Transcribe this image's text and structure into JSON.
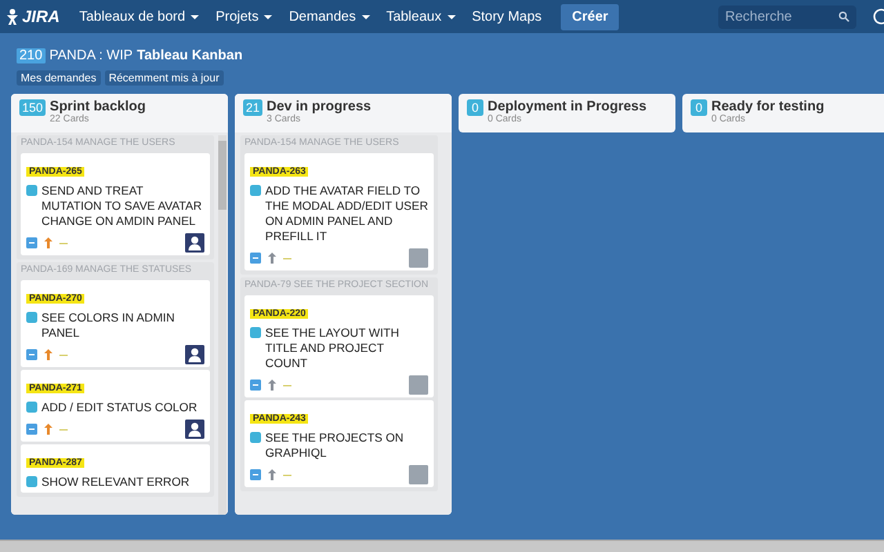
{
  "nav": {
    "logo": "JIRA",
    "menus": [
      {
        "label": "Tableaux de bord",
        "dropdown": true
      },
      {
        "label": "Projets",
        "dropdown": true
      },
      {
        "label": "Demandes",
        "dropdown": true
      },
      {
        "label": "Tableaux",
        "dropdown": true
      },
      {
        "label": "Story Maps",
        "dropdown": false
      }
    ],
    "create": "Créer",
    "search": {
      "placeholder": "Recherche"
    }
  },
  "board": {
    "count": "210",
    "project": "PANDA : WIP",
    "name": "Tableau Kanban",
    "filters": [
      "Mes demandes",
      "Récemment mis à jour"
    ]
  },
  "columns": [
    {
      "count": "150",
      "title": "Sprint backlog",
      "cards_count": "22 Cards",
      "groups": [
        {
          "epic": "PANDA-154 MANAGE THE USERS",
          "cards": [
            {
              "key": "PANDA-265",
              "title": "SEND AND TREAT MUTATION TO SAVE AVATAR CHANGE ON AMDIN PANEL",
              "priority": {
                "color": "#e8892c"
              },
              "avatar": {
                "kind": "silhouette"
              }
            }
          ]
        },
        {
          "epic": "PANDA-169 MANAGE THE STATUSES",
          "cards": [
            {
              "key": "PANDA-270",
              "title": "SEE COLORS IN ADMIN PANEL",
              "priority": {
                "color": "#e8892c"
              },
              "avatar": {
                "kind": "silhouette"
              }
            },
            {
              "key": "PANDA-271",
              "title": "ADD / EDIT STATUS COLOR",
              "priority": {
                "color": "#e8892c"
              },
              "avatar": {
                "kind": "silhouette"
              }
            },
            {
              "key": "PANDA-287",
              "title": "SHOW RELEVANT ERROR"
            }
          ]
        }
      ]
    },
    {
      "count": "21",
      "title": "Dev in progress",
      "cards_count": "3 Cards",
      "groups": [
        {
          "epic": "PANDA-154 MANAGE THE USERS",
          "cards": [
            {
              "key": "PANDA-263",
              "title": "ADD THE AVATAR FIELD TO THE MODAL ADD/EDIT USER ON ADMIN PANEL AND PREFILL IT",
              "priority": {
                "color": "#8a9099"
              },
              "avatar": {
                "kind": "photo"
              }
            }
          ]
        },
        {
          "epic": "PANDA-79 SEE THE PROJECT SECTION",
          "cards": [
            {
              "key": "PANDA-220",
              "title": "SEE THE LAYOUT WITH TITLE AND PROJECT COUNT",
              "priority": {
                "color": "#8a9099"
              },
              "avatar": {
                "kind": "photo"
              }
            },
            {
              "key": "PANDA-243",
              "title": "SEE THE PROJECTS ON GRAPHIQL",
              "priority": {
                "color": "#8a9099"
              },
              "avatar": {
                "kind": "photo"
              }
            }
          ]
        }
      ]
    },
    {
      "count": "0",
      "title": "Deployment in Progress",
      "cards_count": "0 Cards"
    },
    {
      "count": "0",
      "title": "Ready for testing",
      "cards_count": "0 Cards"
    }
  ]
}
